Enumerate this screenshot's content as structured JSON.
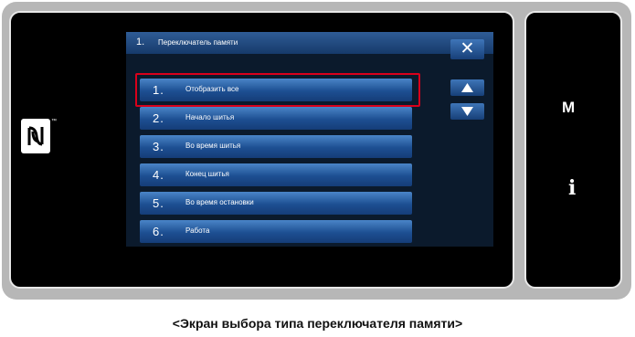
{
  "title": {
    "number": "1.",
    "text": "Переключатель памяти"
  },
  "controls": {
    "close": "✕",
    "m_label": "M",
    "i_label": "i"
  },
  "items": [
    {
      "num": "1.",
      "label": "Отобразить все"
    },
    {
      "num": "2.",
      "label": "Начало шитья"
    },
    {
      "num": "3.",
      "label": "Во время шитья"
    },
    {
      "num": "4.",
      "label": "Конец шитья"
    },
    {
      "num": "5.",
      "label": "Во время остановки"
    },
    {
      "num": "6.",
      "label": "Работа"
    }
  ],
  "caption": "<Экран выбора типа переключателя памяти>",
  "colors": {
    "accent_selection": "#d9001b",
    "button_blue": "#1d4f92"
  },
  "icons": {
    "nfc": "nfc-icon",
    "up": "arrow-up-icon",
    "down": "arrow-down-icon",
    "close": "close-icon"
  }
}
